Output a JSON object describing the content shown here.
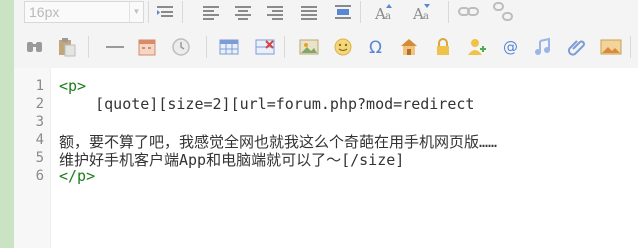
{
  "toolbar": {
    "font_size_value": "16px",
    "row1_icons": [
      "paragraph-indent-icon",
      "align-left-icon",
      "align-center-icon",
      "align-right-icon",
      "align-justify-icon",
      "float-icon",
      "font-up-icon",
      "font-down-icon",
      "link-icon",
      "unlink-icon"
    ],
    "row2_icons": [
      "quote-icon",
      "paste-icon",
      "hr-icon",
      "calendar-icon",
      "clock-icon",
      "table-icon",
      "delete-table-icon",
      "image-icon",
      "smiley-icon",
      "omega-icon",
      "house-icon",
      "lock-icon",
      "user-plus-icon",
      "at-icon",
      "music-icon",
      "attachment-icon",
      "photo-icon"
    ]
  },
  "editor": {
    "lines": [
      {
        "no": "1",
        "text": "<p>",
        "kind": "tag"
      },
      {
        "no": "2",
        "text": "    [quote][size=2][url=forum.php?mod=redirect",
        "kind": "text"
      },
      {
        "no": "3",
        "text": "",
        "kind": "text"
      },
      {
        "no": "4",
        "text": "额，要不算了吧，我感觉全网也就我这么个奇葩在用手机网页版……",
        "kind": "text"
      },
      {
        "no": "5",
        "text": "维护好手机客户端App和电脑端就可以了～[/size]",
        "kind": "text"
      },
      {
        "no": "6",
        "text": "</p>",
        "kind": "tag"
      }
    ]
  },
  "colors": {
    "left_strip": "#c9e3c3",
    "toolbar_bg": "#f4f4f4",
    "tag_green": "#1a7d1a",
    "icon_gray": "#9a9a9a",
    "icon_blue": "#5b86d6",
    "icon_orange": "#f0a020"
  }
}
